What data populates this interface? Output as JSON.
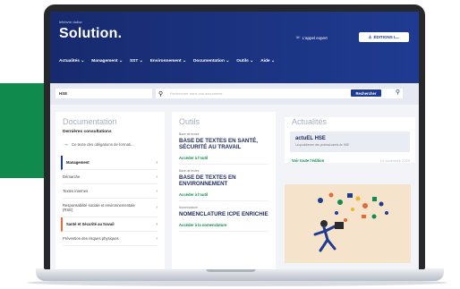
{
  "header": {
    "brand_small": "lefebvre\ndalloz",
    "brand_title": "Solution.",
    "expert_link": "L'appel expert",
    "editions_button": "ÉDITIONS L..."
  },
  "nav": [
    {
      "label": "Actualités"
    },
    {
      "label": "Management"
    },
    {
      "label": "SST"
    },
    {
      "label": "Environnement"
    },
    {
      "label": "Documentation"
    },
    {
      "label": "Outils"
    },
    {
      "label": "Aide"
    }
  ],
  "search": {
    "scope_value": "HSE",
    "placeholder": "Rechercher dans vos documents",
    "button_label": "Rechercher"
  },
  "documentation": {
    "title": "Documentation",
    "subhead": "Dernières consultations",
    "recent": "Ce texte des obligations de formati...",
    "items": [
      {
        "label": "Management"
      },
      {
        "label": "Démarche"
      },
      {
        "label": "Textes internes"
      },
      {
        "label": "Responsabilité sociale et environnementale (RSE)"
      },
      {
        "label": "Santé et Sécurité au travail"
      },
      {
        "label": "Prévention des risques physiques"
      }
    ]
  },
  "outils": {
    "title": "Outils",
    "tools": [
      {
        "category": "Base de textes",
        "name": "BASE DE TEXTES EN SANTÉ, SÉCURITÉ AU TRAVAIL",
        "link": "Accéder à l'outil"
      },
      {
        "category": "Base de textes",
        "name": "BASE DE TEXTES EN ENVIRONNEMENT",
        "link": "Accéder à l'outil"
      },
      {
        "category": "Nomenclature",
        "name": "NOMENCLATURE ICPE ENRICHIE",
        "link": "Accéder à la nomenclature"
      }
    ]
  },
  "actualites": {
    "title": "Actualités",
    "news_name": "actuEL HSE",
    "news_sub": "La quotidienne des professionnels de HSE",
    "link": "Voir toute l'édition",
    "date": "13 novembre 2023"
  },
  "colors": {
    "header": "#1f3b91",
    "accent_green": "#118a4e",
    "page_bg": "#f3f4f7"
  }
}
